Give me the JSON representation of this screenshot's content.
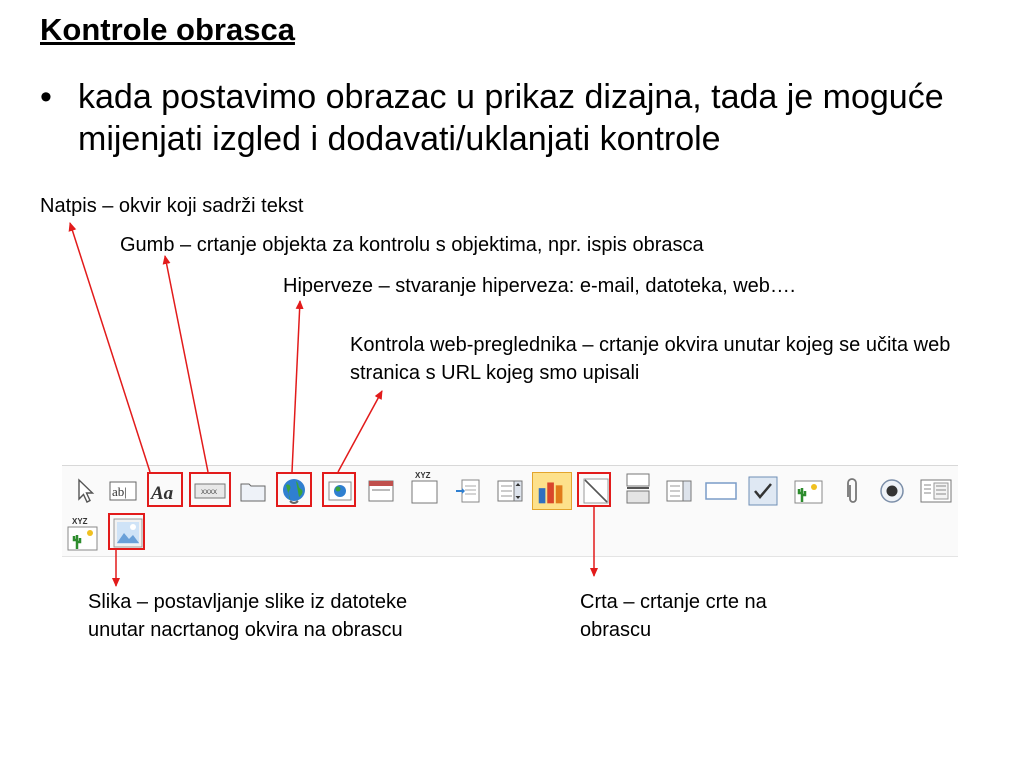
{
  "slide": {
    "title": "Kontrole obrasca",
    "bullet": "kada postavimo obrazac u prikaz dizajna, tada je moguće mijenjati izgled i dodavati/uklanjati kontrole"
  },
  "annotations": {
    "natpis": "Natpis – okvir koji sadrži tekst",
    "gumb": "Gumb – crtanje objekta za kontrolu s objektima, npr. ispis obrasca",
    "hiperveze": "Hiperveze – stvaranje hiperveza: e-mail, datoteka, web….",
    "web_kontrola": "Kontrola web-preglednika – crtanje okvira unutar kojeg se učita web stranica s URL kojeg smo upisali",
    "slika": "Slika – postavljanje slike iz datoteke unutar nacrtanog okvira na obrascu",
    "crta": "Crta – crtanje crte na obrascu"
  },
  "toolbar": {
    "text_box_glyph": "ab|",
    "label_glyph": "Aa",
    "button_caption": "XXXX",
    "option_group_caption": "XYZ",
    "attachment_caption": "XYZ"
  },
  "colors": {
    "highlight": "#e21b1b",
    "arrow": "#e21b1b",
    "selected_tool_bg": "#fde18b"
  }
}
